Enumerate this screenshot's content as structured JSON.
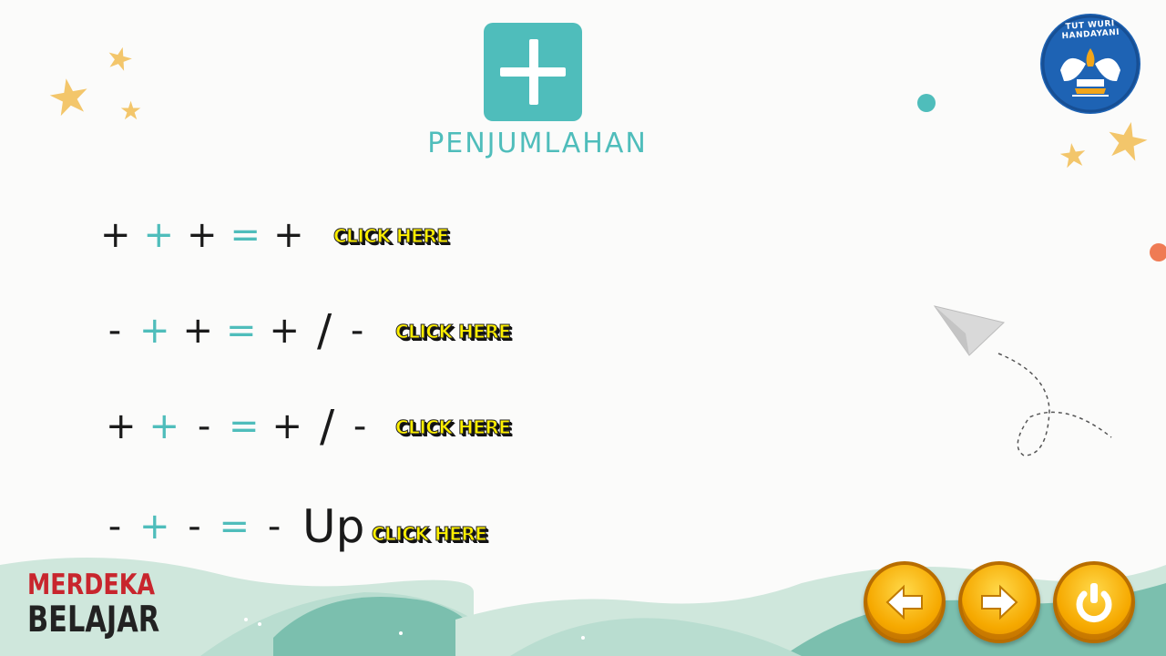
{
  "title": "PENJUMLAHAN",
  "rules": [
    {
      "symbols": [
        {
          "text": "+",
          "color": "black"
        },
        {
          "text": "+",
          "color": "teal"
        },
        {
          "text": "+",
          "color": "black"
        },
        {
          "text": "=",
          "color": "teal"
        },
        {
          "text": "+",
          "color": "black"
        }
      ],
      "action_label": "CLICK HERE"
    },
    {
      "symbols": [
        {
          "text": "-",
          "color": "black"
        },
        {
          "text": "+",
          "color": "teal"
        },
        {
          "text": "+",
          "color": "black"
        },
        {
          "text": "=",
          "color": "teal"
        },
        {
          "text": "+",
          "color": "black"
        },
        {
          "text": "/",
          "color": "black"
        },
        {
          "text": "-",
          "color": "black"
        }
      ],
      "action_label": "CLICK HERE"
    },
    {
      "symbols": [
        {
          "text": "+",
          "color": "black"
        },
        {
          "text": "+",
          "color": "teal"
        },
        {
          "text": "-",
          "color": "black"
        },
        {
          "text": "=",
          "color": "teal"
        },
        {
          "text": "+",
          "color": "black"
        },
        {
          "text": "/",
          "color": "black"
        },
        {
          "text": "-",
          "color": "black"
        }
      ],
      "action_label": "CLICK HERE"
    },
    {
      "symbols": [
        {
          "text": "-",
          "color": "black"
        },
        {
          "text": "+",
          "color": "teal"
        },
        {
          "text": "-",
          "color": "black"
        },
        {
          "text": "=",
          "color": "teal"
        },
        {
          "text": "-",
          "color": "black"
        },
        {
          "text": "Up",
          "color": "black"
        }
      ],
      "action_label": "CLICK HERE"
    }
  ],
  "logo": {
    "arc_text": "TUT WURI HANDAYANI"
  },
  "branding": {
    "line1": "MERDEKA",
    "line2": "BELAJAR"
  },
  "nav": {
    "back_icon": "arrow-left-icon",
    "next_icon": "arrow-right-icon",
    "power_icon": "power-icon"
  },
  "colors": {
    "accent": "#4fbdbb",
    "symbol": "#1a1a1a",
    "click": "#fff000",
    "brand_red": "#c8252d",
    "button": "#f6a900"
  }
}
